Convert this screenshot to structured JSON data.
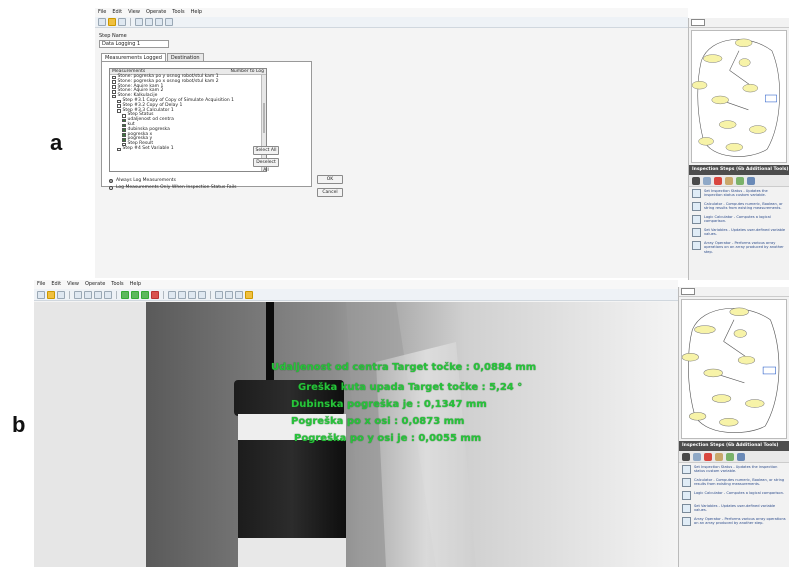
{
  "labels": {
    "a": "a",
    "b": "b"
  },
  "panel_a": {
    "menu": [
      "File",
      "Edit",
      "View",
      "Operate",
      "Tools",
      "Help"
    ],
    "step_name_label": "Step Name",
    "step_name_value": "Data Logging 1",
    "tabs": [
      "Measurements Logged",
      "Destination"
    ],
    "columns": {
      "measurements": "Measurements",
      "number_to_log": "Number to Log"
    },
    "rows": [
      "Stone: pogreska po y osnog robot/stul kam 1",
      "Stone: pogreska po x osnog robot/stul kam 2",
      "Stone: Aquire kam 1",
      "Stone: Aquire kam 2",
      "Stone: Kalkulacije",
      "Step #3.1 Copy of Copy of Simulate Acquisition 1",
      "Step #3.2 Copy of Delay 1",
      "Step #3.3 Calculator 1",
      "Step Status",
      "udaljenost od centra",
      "kut",
      "dubinska pogreska",
      "pogreska x",
      "pogreska y",
      "Step Result",
      "Step #4 Set Variable 1"
    ],
    "row_checked": [
      false,
      false,
      false,
      false,
      false,
      false,
      false,
      false,
      false,
      true,
      true,
      true,
      true,
      true,
      false,
      false
    ],
    "row_indent": [
      0,
      0,
      0,
      0,
      0,
      1,
      1,
      1,
      2,
      2,
      2,
      2,
      2,
      2,
      2,
      1
    ],
    "buttons": {
      "select_all": "Select All",
      "deselect_all": "Deselect All",
      "ok": "OK",
      "cancel": "Cancel"
    },
    "radios": [
      "Always Log Measurements",
      "Log Measurements Only When Inspection Status Fails"
    ]
  },
  "sidebar": {
    "header": "Inspection Steps (6b Additional Tools)",
    "items": [
      "Set Inspection Status - Updates the inspection status custom variable.",
      "Calculator - Computes numeric, Boolean, or string results from existing measurements.",
      "Logic Calculator - Computes a logical comparison.",
      "Set Variables - Updates user-defined variable values.",
      "Array Operator - Performs various array operations on an array produced by another step."
    ]
  },
  "panel_b": {
    "menu": [
      "File",
      "Edit",
      "View",
      "Operate",
      "Tools",
      "Help"
    ],
    "overlay": [
      "Udaljenost od centra Target točke : 0,0884 mm",
      "Greška kuta upada Target točke : 5,24 °",
      "Dubinska pogreška je : 0,1347 mm",
      "Pogreška po x osi : 0,0873 mm",
      "Pogreška po y osi je : 0,0055 mm"
    ],
    "overlay_color": "#27c43a"
  }
}
